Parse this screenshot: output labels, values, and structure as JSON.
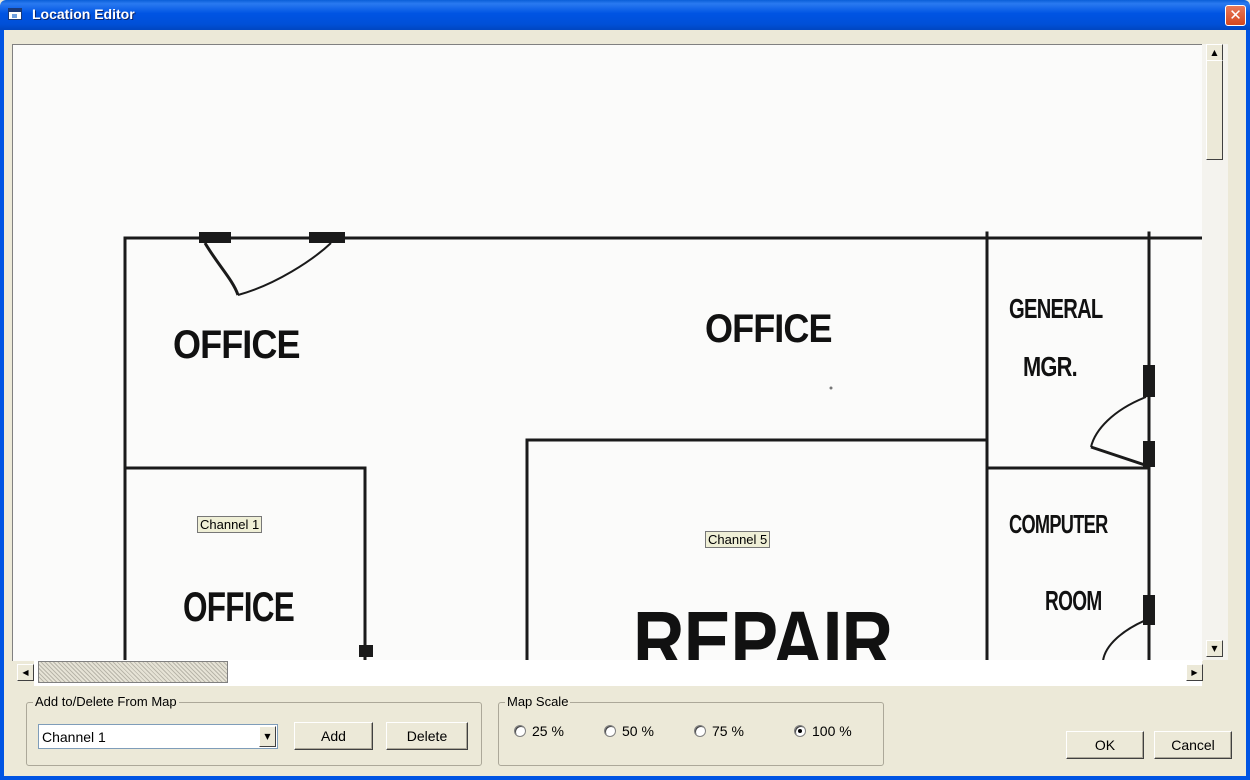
{
  "window": {
    "title": "Location Editor",
    "close_glyph": "✕"
  },
  "map": {
    "rooms": [
      {
        "id": "office-top-left",
        "label": "OFFICE"
      },
      {
        "id": "office-top-center",
        "label": "OFFICE"
      },
      {
        "id": "general-mgr-line1",
        "label": "GENERAL"
      },
      {
        "id": "general-mgr-line2",
        "label": "MGR."
      },
      {
        "id": "computer-room-line1",
        "label": "COMPUTER"
      },
      {
        "id": "computer-room-line2",
        "label": "ROOM"
      },
      {
        "id": "office-left",
        "label": "OFFICE"
      },
      {
        "id": "repair",
        "label": "REPAIR"
      }
    ],
    "channels": [
      {
        "label": "Channel 1"
      },
      {
        "label": "Channel 5"
      }
    ]
  },
  "scroll": {
    "up_glyph": "▲",
    "down_glyph": "▼",
    "left_glyph": "◀",
    "right_glyph": "▶"
  },
  "add_delete_group": {
    "legend": "Add to/Delete From Map",
    "selected_channel": "Channel 1",
    "dropdown_glyph": "▼",
    "add_label": "Add",
    "delete_label": "Delete"
  },
  "map_scale_group": {
    "legend": "Map Scale",
    "options": [
      {
        "label": "25 %",
        "checked": false
      },
      {
        "label": "50 %",
        "checked": false
      },
      {
        "label": "75 %",
        "checked": false
      },
      {
        "label": "100 %",
        "checked": true
      }
    ]
  },
  "footer": {
    "ok_label": "OK",
    "cancel_label": "Cancel"
  }
}
